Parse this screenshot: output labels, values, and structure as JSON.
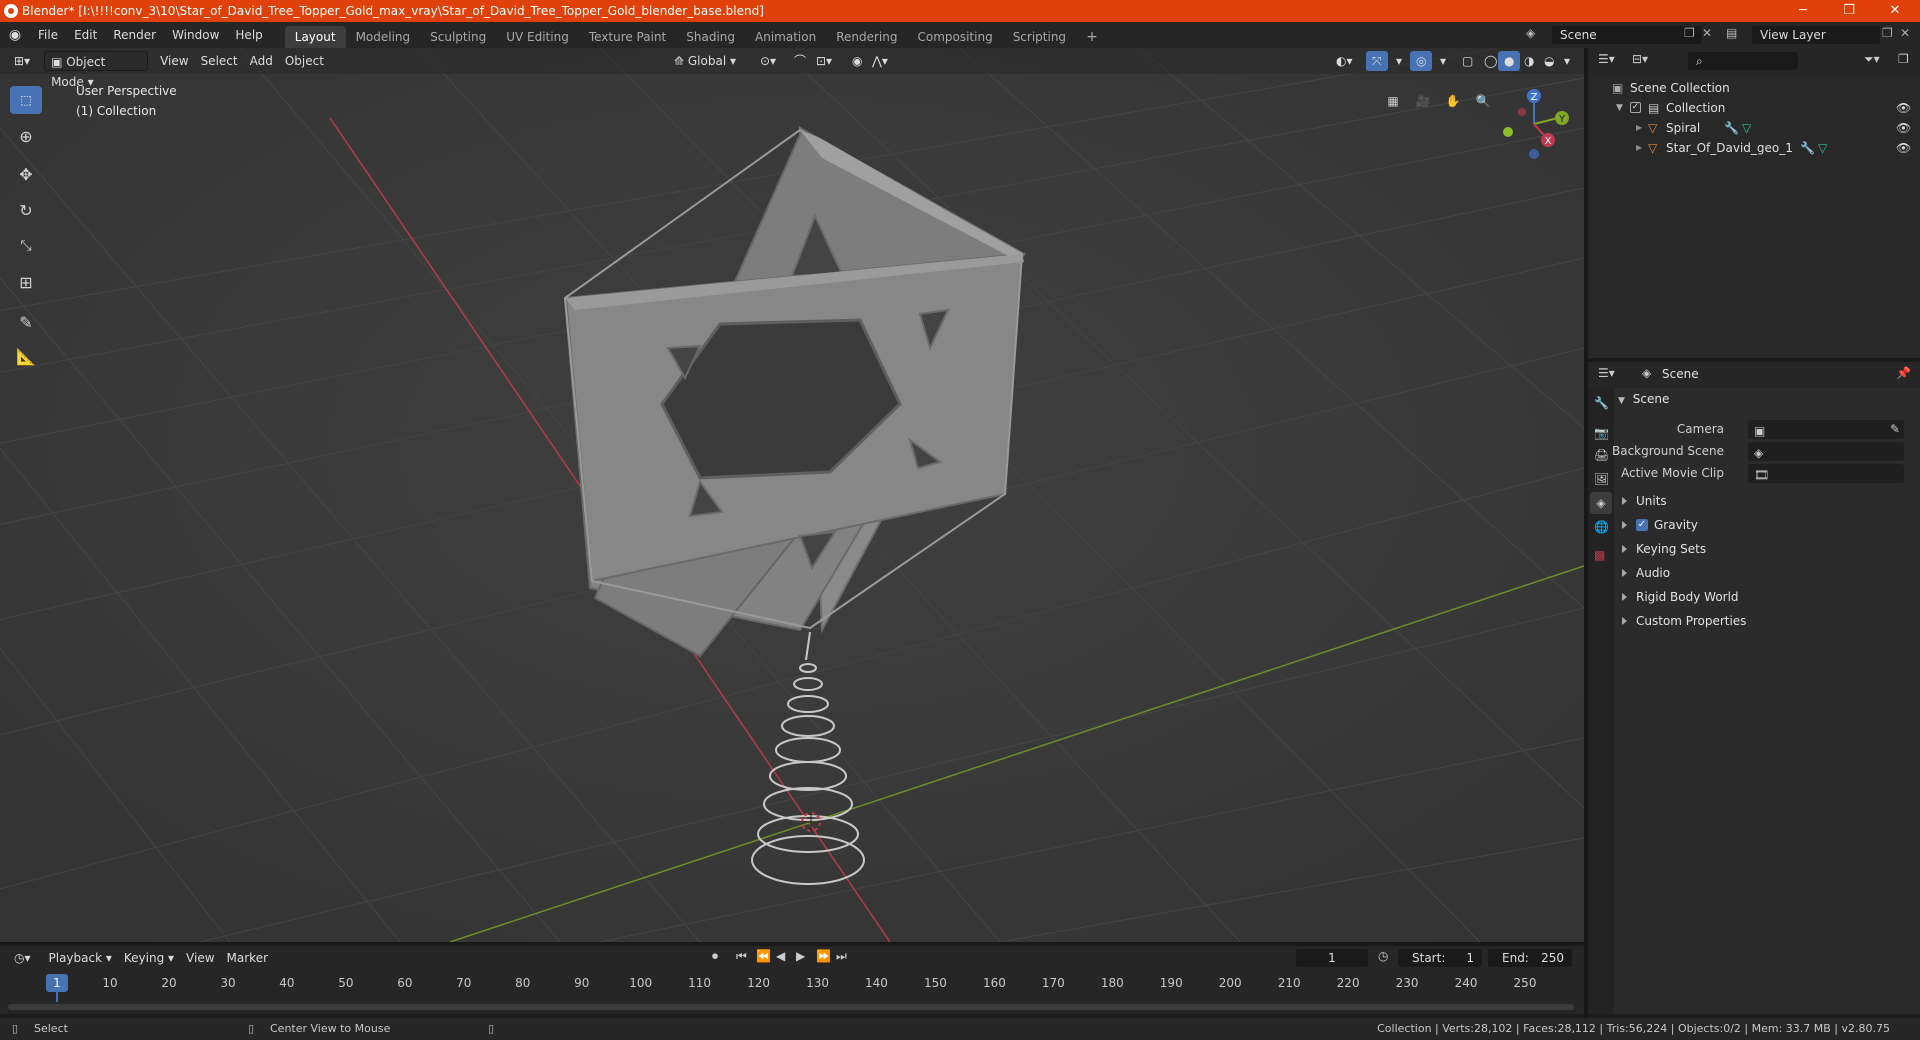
{
  "window": {
    "title": "Blender* [I:\\!!!!conv_3\\10\\Star_of_David_Tree_Topper_Gold_max_vray\\Star_of_David_Tree_Topper_Gold_blender_base.blend]",
    "minimize": "─",
    "maximize": "❐",
    "close": "✕"
  },
  "menu": [
    "File",
    "Edit",
    "Render",
    "Window",
    "Help"
  ],
  "workspaces": [
    "Layout",
    "Modeling",
    "Sculpting",
    "UV Editing",
    "Texture Paint",
    "Shading",
    "Animation",
    "Rendering",
    "Compositing",
    "Scripting"
  ],
  "active_workspace": "Layout",
  "scene_field": "Scene",
  "view_layer_field": "View Layer",
  "viewport": {
    "mode": "Object Mode",
    "menus": [
      "View",
      "Select",
      "Add",
      "Object"
    ],
    "transform_orientation": "Global",
    "overlay_title": "User Perspective",
    "overlay_collection": "(1) Collection",
    "gizmo_axes": {
      "z": "Z",
      "y": "Y",
      "x": "X"
    }
  },
  "outliner": {
    "root": "Scene Collection",
    "collection": "Collection",
    "objects": [
      "Spiral",
      "Star_Of_David_geo_1"
    ]
  },
  "properties": {
    "tab_title": "Scene",
    "panel": "Scene",
    "fields": [
      {
        "label": "Camera"
      },
      {
        "label": "Background Scene"
      },
      {
        "label": "Active Movie Clip"
      }
    ],
    "sections": [
      "Units",
      "Gravity",
      "Keying Sets",
      "Audio",
      "Rigid Body World",
      "Custom Properties"
    ],
    "gravity_checked": true
  },
  "timeline": {
    "menus": [
      "Playback",
      "Keying",
      "View",
      "Marker"
    ],
    "current_frame": "1",
    "start_label": "Start:",
    "start": "1",
    "end_label": "End:",
    "end": "250",
    "ticks": [
      "1",
      "10",
      "20",
      "30",
      "40",
      "50",
      "60",
      "70",
      "80",
      "90",
      "100",
      "110",
      "120",
      "130",
      "140",
      "150",
      "160",
      "170",
      "180",
      "190",
      "200",
      "210",
      "220",
      "230",
      "240",
      "250"
    ]
  },
  "status": {
    "left": "Select",
    "middle": "Center View to Mouse",
    "right": "Collection | Verts:28,102 | Faces:28,112 | Tris:56,224 | Objects:0/2 | Mem: 33.7 MB | v2.80.75"
  },
  "colors": {
    "titlebar": "#e0400a",
    "accent": "#4772b3",
    "x_axis": "#c0394b",
    "y_axis": "#7fa827",
    "z_axis": "#3d73c9"
  }
}
